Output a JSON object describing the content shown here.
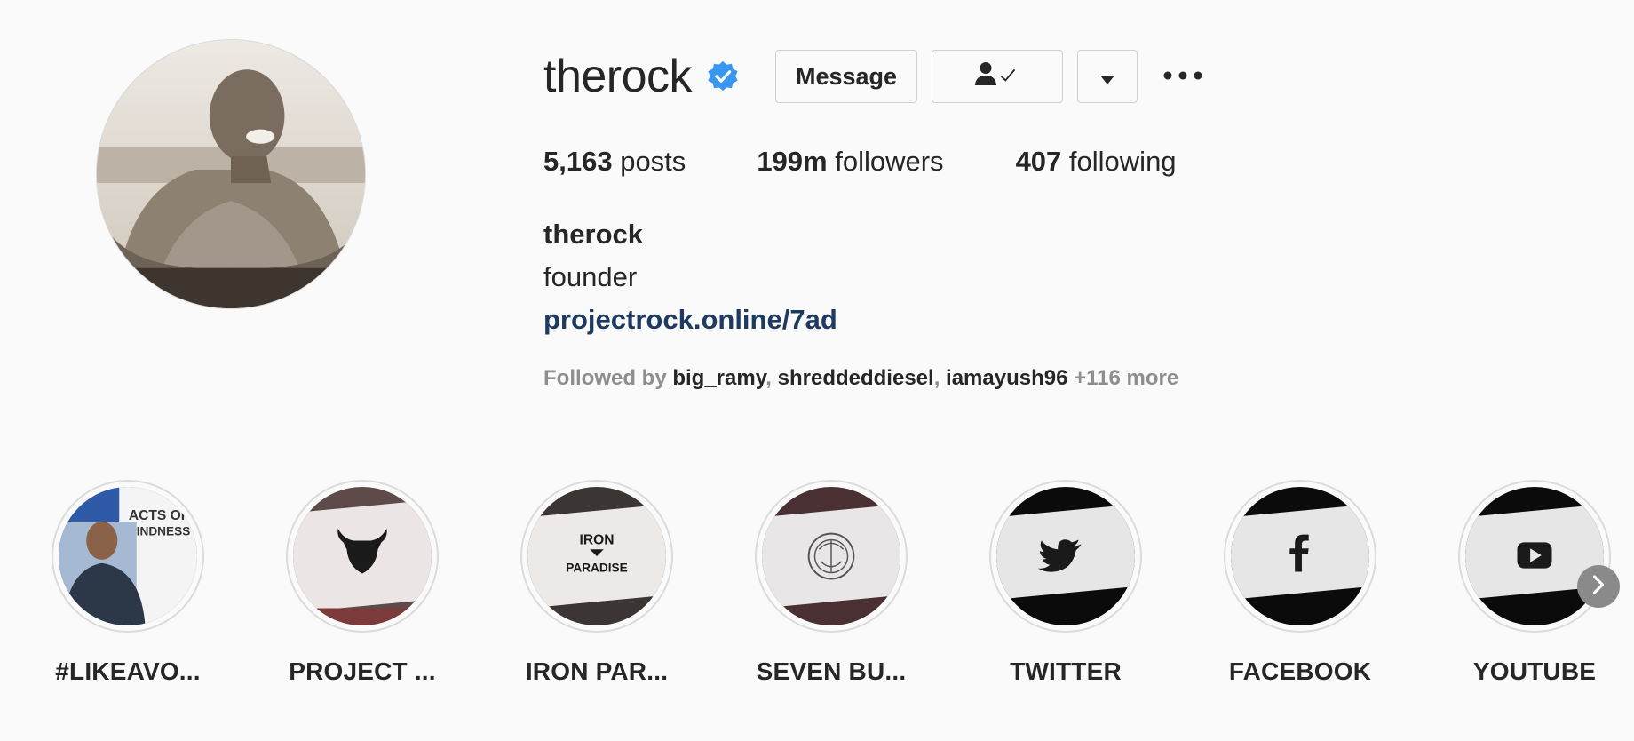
{
  "profile": {
    "username": "therock",
    "full_name": "therock",
    "bio": "founder",
    "link": "projectrock.online/7ad",
    "verified_icon": "verified-badge-icon",
    "accent_color": "#3897f0",
    "link_color": "#1f3a60"
  },
  "actions": {
    "message_label": "Message",
    "following_icon": "person-check-icon",
    "dropdown_icon": "caret-down-icon",
    "more_icon": "ellipsis-icon"
  },
  "stats": {
    "posts_count": "5,163",
    "posts_label": "posts",
    "followers_count": "199m",
    "followers_label": "followers",
    "following_count": "407",
    "following_label": "following"
  },
  "followed_by": {
    "prefix": "Followed by",
    "users": [
      "big_ramy",
      "shreddeddiesel",
      "iamayush96"
    ],
    "more": "+116 more"
  },
  "highlights": [
    {
      "label": "#LIKEAVO...",
      "cover_text_1": "ACTS OF",
      "cover_text_2": "KINDNESS",
      "icon": "book-cover-icon"
    },
    {
      "label": "PROJECT ...",
      "icon": "bull-logo-icon"
    },
    {
      "label": "IRON PAR...",
      "cover_text_1": "IRON",
      "cover_text_2": "PARADISE",
      "icon": "iron-paradise-logo-icon"
    },
    {
      "label": "SEVEN BU...",
      "icon": "seven-bucks-logo-icon"
    },
    {
      "label": "TWITTER",
      "icon": "twitter-bird-icon"
    },
    {
      "label": "FACEBOOK",
      "icon": "facebook-f-icon"
    },
    {
      "label": "YOUTUBE",
      "icon": "youtube-play-icon"
    }
  ],
  "next_icon": "chevron-right-icon"
}
